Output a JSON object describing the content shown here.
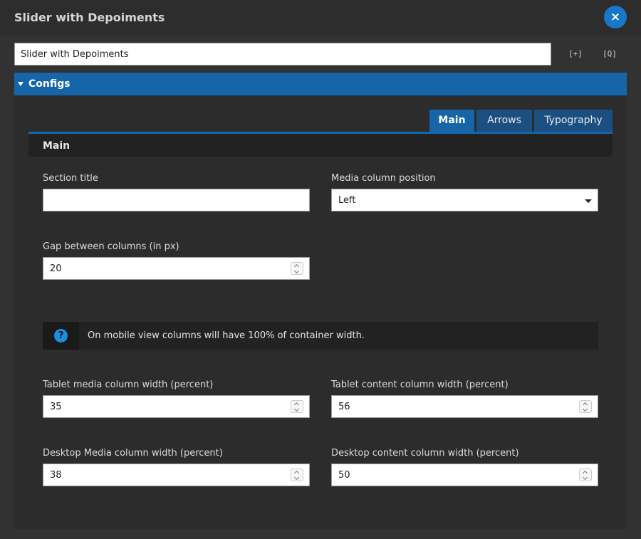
{
  "window": {
    "title": "Slider with Depoiments",
    "close_icon": "×"
  },
  "toolbar": {
    "name_value": "Slider with Depoiments",
    "expand_label": "[+]",
    "search_label": "[Q]"
  },
  "configs": {
    "label": "Configs"
  },
  "tabs": [
    {
      "label": "Main",
      "active": true
    },
    {
      "label": "Arrows",
      "active": false
    },
    {
      "label": "Typography",
      "active": false
    }
  ],
  "section": {
    "title": "Main"
  },
  "fields": {
    "section_title": {
      "label": "Section title",
      "value": ""
    },
    "media_position": {
      "label": "Media column position",
      "value": "Left"
    },
    "gap": {
      "label": "Gap between columns (in px)",
      "value": "20"
    },
    "tablet_media": {
      "label": "Tablet media column width (percent)",
      "value": "35"
    },
    "tablet_content": {
      "label": "Tablet content column width (percent)",
      "value": "56"
    },
    "desktop_media": {
      "label": "Desktop Media column width (percent)",
      "value": "38"
    },
    "desktop_content": {
      "label": "Desktop content column width (percent)",
      "value": "50"
    }
  },
  "info": {
    "icon_glyph": "?",
    "text": "On mobile view columns will have 100% of container width."
  },
  "colors": {
    "accent": "#1565a8",
    "tab_inactive": "#1b4f82",
    "close": "#1877c9",
    "info_icon": "#1b8fe0"
  }
}
